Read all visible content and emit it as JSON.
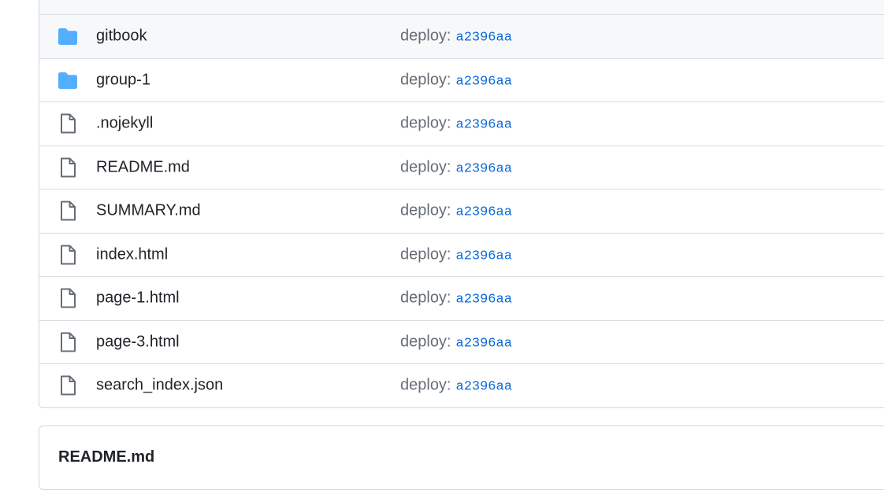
{
  "files": [
    {
      "type": "folder",
      "icon": "folder-icon",
      "name": "",
      "commit_prefix": "",
      "commit_sha": ""
    },
    {
      "type": "folder",
      "icon": "folder-icon",
      "name": "gitbook",
      "commit_prefix": "deploy:",
      "commit_sha": "a2396aa"
    },
    {
      "type": "folder",
      "icon": "folder-icon",
      "name": "group-1",
      "commit_prefix": "deploy:",
      "commit_sha": "a2396aa"
    },
    {
      "type": "file",
      "icon": "file-icon",
      "name": ".nojekyll",
      "commit_prefix": "deploy:",
      "commit_sha": "a2396aa"
    },
    {
      "type": "file",
      "icon": "file-icon",
      "name": "README.md",
      "commit_prefix": "deploy:",
      "commit_sha": "a2396aa"
    },
    {
      "type": "file",
      "icon": "file-icon",
      "name": "SUMMARY.md",
      "commit_prefix": "deploy:",
      "commit_sha": "a2396aa"
    },
    {
      "type": "file",
      "icon": "file-icon",
      "name": "index.html",
      "commit_prefix": "deploy:",
      "commit_sha": "a2396aa"
    },
    {
      "type": "file",
      "icon": "file-icon",
      "name": "page-1.html",
      "commit_prefix": "deploy:",
      "commit_sha": "a2396aa"
    },
    {
      "type": "file",
      "icon": "file-icon",
      "name": "page-3.html",
      "commit_prefix": "deploy:",
      "commit_sha": "a2396aa"
    },
    {
      "type": "file",
      "icon": "file-icon",
      "name": "search_index.json",
      "commit_prefix": "deploy:",
      "commit_sha": "a2396aa"
    }
  ],
  "readme": {
    "title": "README.md"
  },
  "colors": {
    "folder": "#54aeff",
    "file_icon": "#656d76",
    "link": "#0969da",
    "hover_row": "#f6f8fa"
  }
}
